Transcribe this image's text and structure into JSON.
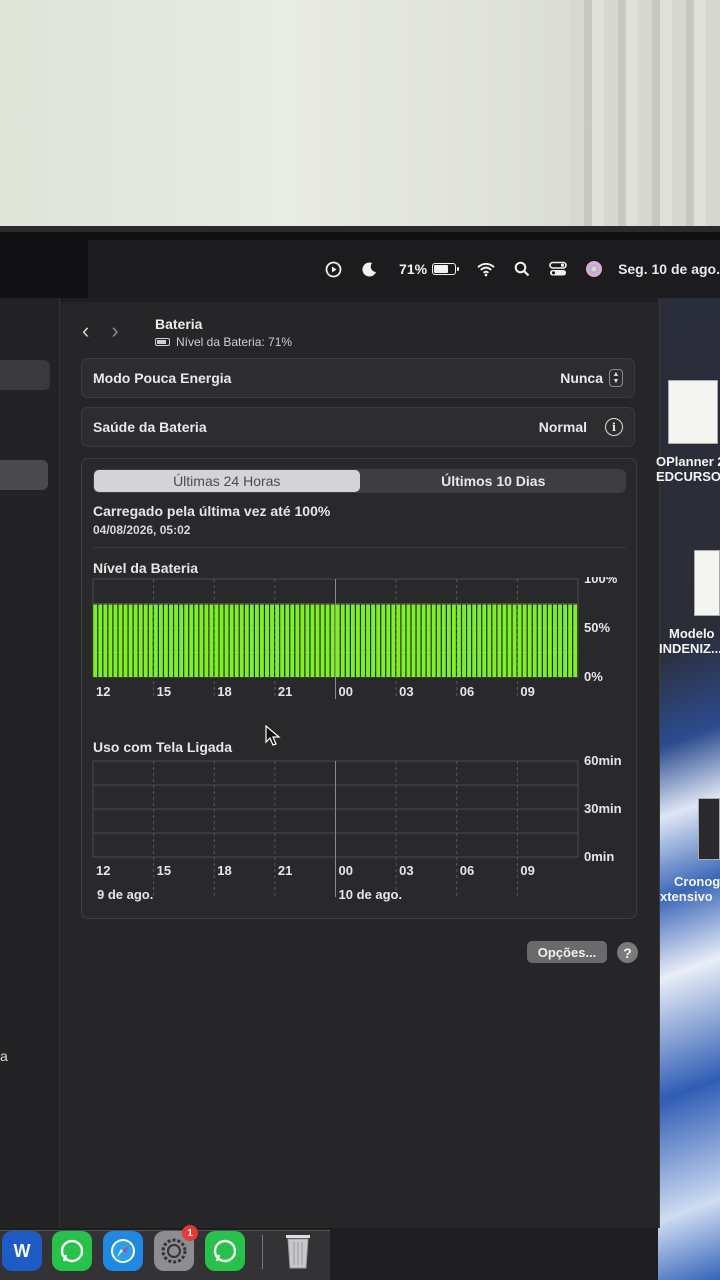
{
  "menubar": {
    "battery_percent": "71%",
    "battery_fraction": 0.71,
    "date": "Seg. 10 de ago."
  },
  "window": {
    "title": "Bateria",
    "subtitle": "Nível da Bateria: 71%",
    "low_power_label": "Modo Pouca Energia",
    "low_power_value": "Nunca",
    "health_label": "Saúde da Bateria",
    "health_value": "Normal",
    "tabs": [
      "Últimas 24 Horas",
      "Últimos 10 Dias"
    ],
    "active_tab": 0,
    "last_charged_label": "Carregado pela última vez até 100%",
    "last_charged_date": "04/08/2026, 05:02",
    "battery_section_title": "Nível da Bateria",
    "usage_section_title": "Uso com Tela Ligada",
    "options_label": "Opções...",
    "help_label": "?"
  },
  "chart_data": [
    {
      "type": "bar",
      "title": "Nível da Bateria",
      "x_ticks": [
        "12",
        "15",
        "18",
        "21",
        "00",
        "03",
        "06",
        "09"
      ],
      "y_ticks": [
        "100%",
        "50%",
        "0%"
      ],
      "ylim": [
        0,
        100
      ],
      "bar_count": 96,
      "values_constant": 74,
      "bar_color": "#7cf21e",
      "grid": true
    },
    {
      "type": "bar",
      "title": "Uso com Tela Ligada",
      "x_ticks": [
        "12",
        "15",
        "18",
        "21",
        "00",
        "03",
        "06",
        "09"
      ],
      "y_ticks": [
        "60min",
        "30min",
        "0min"
      ],
      "ylim": [
        0,
        60
      ],
      "values": [],
      "day_labels": [
        "9 de ago.",
        "10 de ago."
      ],
      "grid": true
    }
  ],
  "desktop": {
    "icons": [
      {
        "label_line1": "OPlanner 2",
        "label_line2": "EDCURSO."
      },
      {
        "label_line1": "Modelo",
        "label_line2": "INDENIZ..."
      },
      {
        "label_line1": "Cronog",
        "label_line2": "xtensivo"
      }
    ]
  },
  "sidebar": {
    "partial_text": "a"
  },
  "dock": {
    "items": [
      "word-icon",
      "whatsapp-icon",
      "safari-icon",
      "settings-icon",
      "whatsapp-icon",
      "trash-icon"
    ],
    "settings_badge": "1"
  },
  "colors": {
    "accent_green": "#7cf21e",
    "window_bg": "#262629"
  }
}
